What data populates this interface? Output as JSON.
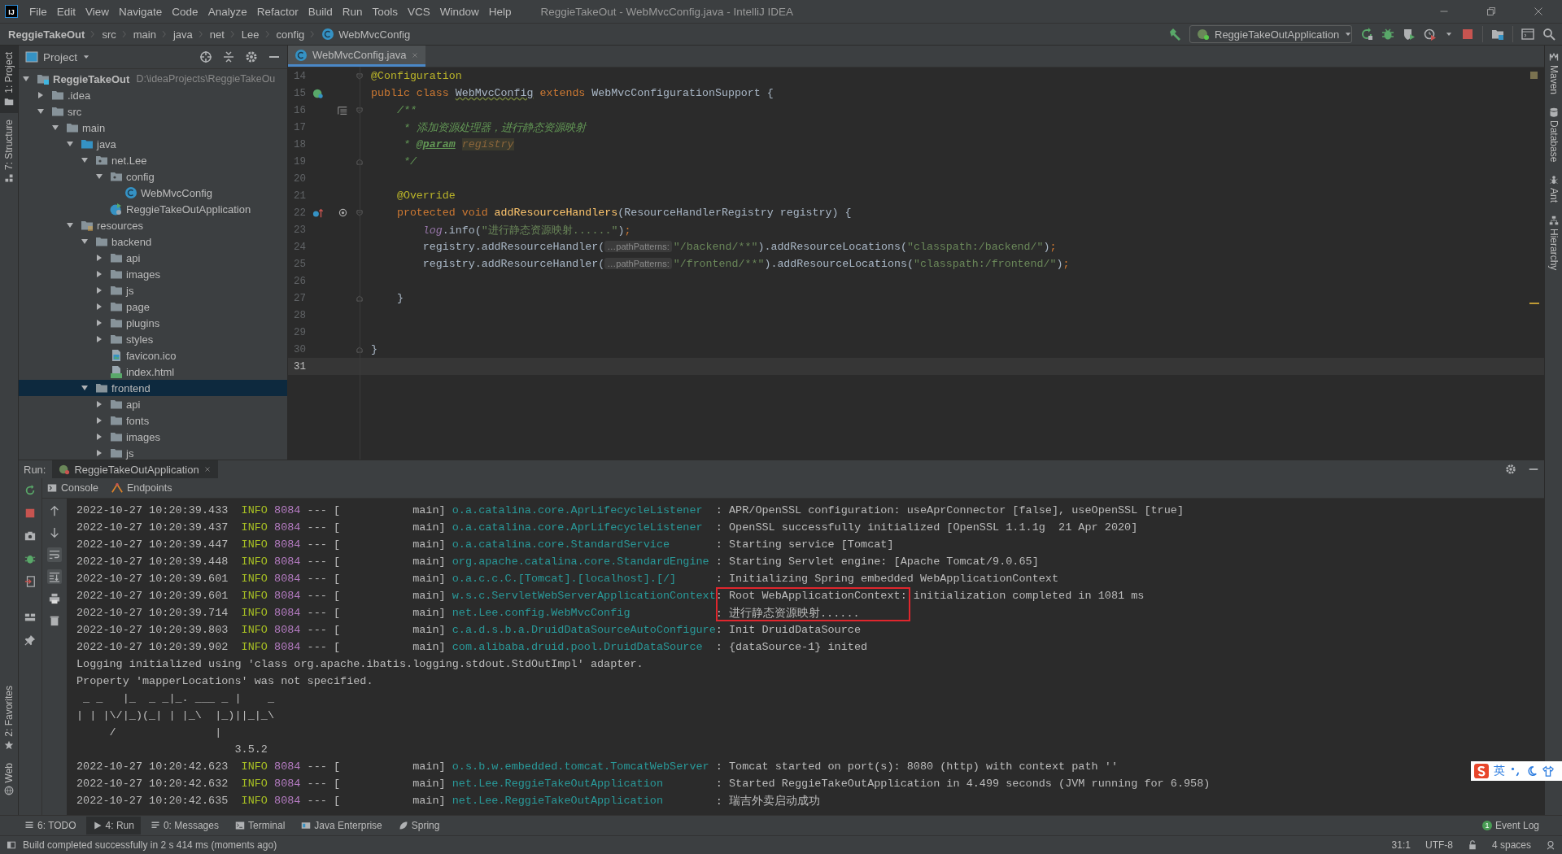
{
  "app_logo": "IJ",
  "menu": [
    "File",
    "Edit",
    "View",
    "Navigate",
    "Code",
    "Analyze",
    "Refactor",
    "Build",
    "Run",
    "Tools",
    "VCS",
    "Window",
    "Help"
  ],
  "window": {
    "title": "ReggieTakeOut - WebMvcConfig.java - IntelliJ IDEA"
  },
  "breadcrumb": [
    {
      "label": "ReggieTakeOut",
      "kind": "project"
    },
    {
      "label": "src",
      "kind": "folder"
    },
    {
      "label": "main",
      "kind": "folder"
    },
    {
      "label": "java",
      "kind": "folder"
    },
    {
      "label": "net",
      "kind": "folder"
    },
    {
      "label": "Lee",
      "kind": "folder"
    },
    {
      "label": "config",
      "kind": "folder"
    },
    {
      "label": "WebMvcConfig",
      "kind": "class"
    }
  ],
  "run_config": {
    "label": "ReggieTakeOutApplication"
  },
  "left_tool_windows": [
    {
      "label": "1: Project",
      "kind": "project",
      "selected": true
    },
    {
      "label": "7: Structure",
      "kind": "structure",
      "selected": false
    }
  ],
  "left_tool_windows_bottom": [
    {
      "label": "2: Favorites",
      "kind": "favorites",
      "selected": false
    },
    {
      "label": "Web",
      "kind": "web",
      "selected": false
    }
  ],
  "right_tool_windows": [
    {
      "label": "Maven",
      "kind": "maven"
    },
    {
      "label": "Database",
      "kind": "database"
    },
    {
      "label": "Ant",
      "kind": "ant"
    },
    {
      "label": "Hierarchy",
      "kind": "hierarchy"
    }
  ],
  "project_panel": {
    "title": "Project",
    "tree": [
      {
        "label": "ReggieTakeOut",
        "kind": "project",
        "path": "D:\\ideaProjects\\ReggieTakeOu",
        "expanded": true,
        "selected": false,
        "children": [
          {
            "label": ".idea",
            "kind": "folder",
            "expanded": false,
            "selected": false
          },
          {
            "label": "src",
            "kind": "folder",
            "expanded": true,
            "selected": false,
            "children": [
              {
                "label": "main",
                "kind": "folder",
                "expanded": true,
                "selected": false,
                "children": [
                  {
                    "label": "java",
                    "kind": "source-folder",
                    "expanded": true,
                    "selected": false,
                    "children": [
                      {
                        "label": "net.Lee",
                        "kind": "package",
                        "expanded": true,
                        "selected": false,
                        "children": [
                          {
                            "label": "config",
                            "kind": "package",
                            "expanded": true,
                            "selected": false,
                            "children": [
                              {
                                "label": "WebMvcConfig",
                                "kind": "class",
                                "selected": false
                              }
                            ]
                          },
                          {
                            "label": "ReggieTakeOutApplication",
                            "kind": "app-class",
                            "selected": false
                          }
                        ]
                      }
                    ]
                  },
                  {
                    "label": "resources",
                    "kind": "resources-folder",
                    "expanded": true,
                    "selected": false,
                    "children": [
                      {
                        "label": "backend",
                        "kind": "folder",
                        "expanded": true,
                        "selected": false,
                        "children": [
                          {
                            "label": "api",
                            "kind": "folder",
                            "expanded": false,
                            "selected": false
                          },
                          {
                            "label": "images",
                            "kind": "folder",
                            "expanded": false,
                            "selected": false
                          },
                          {
                            "label": "js",
                            "kind": "folder",
                            "expanded": false,
                            "selected": false
                          },
                          {
                            "label": "page",
                            "kind": "folder",
                            "expanded": false,
                            "selected": false
                          },
                          {
                            "label": "plugins",
                            "kind": "folder",
                            "expanded": false,
                            "selected": false
                          },
                          {
                            "label": "styles",
                            "kind": "folder",
                            "expanded": false,
                            "selected": false
                          },
                          {
                            "label": "favicon.ico",
                            "kind": "image-file",
                            "selected": false
                          },
                          {
                            "label": "index.html",
                            "kind": "html-file",
                            "selected": false
                          }
                        ]
                      },
                      {
                        "label": "frontend",
                        "kind": "folder",
                        "expanded": true,
                        "selected": true,
                        "children": [
                          {
                            "label": "api",
                            "kind": "folder",
                            "expanded": false,
                            "selected": false
                          },
                          {
                            "label": "fonts",
                            "kind": "folder",
                            "expanded": false,
                            "selected": false
                          },
                          {
                            "label": "images",
                            "kind": "folder",
                            "expanded": false,
                            "selected": false
                          },
                          {
                            "label": "js",
                            "kind": "folder",
                            "expanded": false,
                            "selected": false
                          }
                        ]
                      }
                    ]
                  }
                ]
              }
            ]
          }
        ]
      }
    ]
  },
  "editor": {
    "tabs": [
      {
        "label": "WebMvcConfig.java",
        "selected": true
      }
    ],
    "lines": [
      {
        "number": "14",
        "kind": "plain",
        "current": false,
        "fold_start": true,
        "fold_end": false,
        "tokens": [
          {
            "text": "@Configuration",
            "kind": "annotation"
          }
        ]
      },
      {
        "number": "15",
        "kind": "bean",
        "current": false,
        "fold_start": false,
        "fold_end": false,
        "tokens": [
          {
            "text": "public class ",
            "kind": "keyword"
          },
          {
            "text": "WebMvcConfig",
            "kind": "class-name"
          },
          {
            "text": " extends ",
            "kind": "keyword"
          },
          {
            "text": "WebMvcConfigurationSupport {",
            "kind": "plain"
          }
        ]
      },
      {
        "number": "16",
        "kind": "doc",
        "current": false,
        "fold_start": true,
        "fold_end": false,
        "tokens": [
          {
            "text": "    /**",
            "kind": "doc"
          }
        ]
      },
      {
        "number": "17",
        "kind": "plain",
        "current": false,
        "fold_start": false,
        "fold_end": false,
        "tokens": [
          {
            "text": "     * 添加资源处理器，进行静态资源映射",
            "kind": "doc"
          }
        ]
      },
      {
        "number": "18",
        "kind": "plain",
        "current": false,
        "fold_start": false,
        "fold_end": false,
        "tokens": [
          {
            "text": "     * ",
            "kind": "doc"
          },
          {
            "text": "@param",
            "kind": "doc-tag"
          },
          {
            "text": "registry",
            "kind": "param-ref"
          }
        ]
      },
      {
        "number": "19",
        "kind": "plain",
        "current": false,
        "fold_start": false,
        "fold_end": true,
        "tokens": [
          {
            "text": "     */",
            "kind": "doc"
          }
        ]
      },
      {
        "number": "20",
        "kind": "plain",
        "current": false,
        "fold_start": false,
        "fold_end": false
      },
      {
        "number": "21",
        "kind": "plain",
        "current": false,
        "fold_start": false,
        "fold_end": false,
        "tokens": [
          {
            "text": "    @Override",
            "kind": "annotation"
          }
        ]
      },
      {
        "number": "22",
        "kind": "override",
        "current": false,
        "fold_start": true,
        "fold_end": false,
        "tokens": [
          {
            "text": "    protected void ",
            "kind": "keyword"
          },
          {
            "text": "addResourceHandlers",
            "kind": "method-decl"
          },
          {
            "text": "(ResourceHandlerRegistry registry) {",
            "kind": "plain"
          }
        ]
      },
      {
        "number": "23",
        "kind": "plain",
        "current": false,
        "fold_start": false,
        "fold_end": false,
        "tokens": [
          {
            "text": "        log",
            "kind": "field"
          },
          {
            "text": ".info(",
            "kind": "plain"
          },
          {
            "text": "\"进行静态资源映射......\"",
            "kind": "string"
          },
          {
            "text": ")",
            "kind": "plain"
          },
          {
            "text": ";",
            "kind": "keyword"
          }
        ]
      },
      {
        "number": "24",
        "kind": "plain",
        "current": false,
        "fold_start": false,
        "fold_end": false,
        "tokens": [
          {
            "text": "        registry.addResourceHandler(",
            "kind": "plain"
          },
          {
            "text": "…pathPatterns:",
            "kind": "hint"
          },
          {
            "text": "\"/backend/**\"",
            "kind": "string"
          },
          {
            "text": ").addResourceLocations(",
            "kind": "plain"
          },
          {
            "text": "\"classpath:/backend/\"",
            "kind": "string"
          },
          {
            "text": ")",
            "kind": "plain"
          },
          {
            "text": ";",
            "kind": "keyword"
          }
        ]
      },
      {
        "number": "25",
        "kind": "plain",
        "current": false,
        "fold_start": false,
        "fold_end": false,
        "tokens": [
          {
            "text": "        registry.addResourceHandler(",
            "kind": "plain"
          },
          {
            "text": "…pathPatterns:",
            "kind": "hint"
          },
          {
            "text": "\"/frontend/**\"",
            "kind": "string"
          },
          {
            "text": ").addResourceLocations(",
            "kind": "plain"
          },
          {
            "text": "\"classpath:/frontend/\"",
            "kind": "string"
          },
          {
            "text": ")",
            "kind": "plain"
          },
          {
            "text": ";",
            "kind": "keyword"
          }
        ]
      },
      {
        "number": "26",
        "kind": "plain",
        "current": false,
        "fold_start": false,
        "fold_end": false
      },
      {
        "number": "27",
        "kind": "plain",
        "current": false,
        "fold_start": false,
        "fold_end": true,
        "tokens": [
          {
            "text": "    }",
            "kind": "plain"
          }
        ]
      },
      {
        "number": "28",
        "kind": "plain",
        "current": false,
        "fold_start": false,
        "fold_end": false
      },
      {
        "number": "29",
        "kind": "plain",
        "current": false,
        "fold_start": false,
        "fold_end": false
      },
      {
        "number": "30",
        "kind": "plain",
        "current": false,
        "fold_start": false,
        "fold_end": true,
        "tokens": [
          {
            "text": "}",
            "kind": "plain"
          }
        ]
      },
      {
        "number": "31",
        "kind": "plain",
        "current": true,
        "fold_start": false,
        "fold_end": false
      }
    ]
  },
  "run_panel": {
    "label": "Run:",
    "tabs": [
      {
        "label": "ReggieTakeOutApplication",
        "selected": true
      }
    ],
    "subtabs": [
      {
        "label": "Console",
        "kind": "console"
      },
      {
        "label": "Endpoints",
        "kind": "endpoints"
      }
    ],
    "console": [
      {
        "kind": "log",
        "boxed": false,
        "time": "2022-10-27 10:20:39.433",
        "level": "INFO",
        "pid": "8084",
        "thread": "--- [           main]",
        "logger": "o.a.catalina.core.AprLifecycleListener",
        "message": ": APR/OpenSSL configuration: useAprConnector [false], useOpenSSL [true]"
      },
      {
        "kind": "log",
        "boxed": false,
        "time": "2022-10-27 10:20:39.437",
        "level": "INFO",
        "pid": "8084",
        "thread": "--- [           main]",
        "logger": "o.a.catalina.core.AprLifecycleListener",
        "message": ": OpenSSL successfully initialized [OpenSSL 1.1.1g  21 Apr 2020]"
      },
      {
        "kind": "log",
        "boxed": false,
        "time": "2022-10-27 10:20:39.447",
        "level": "INFO",
        "pid": "8084",
        "thread": "--- [           main]",
        "logger": "o.a.catalina.core.StandardService",
        "message": ": Starting service [Tomcat]"
      },
      {
        "kind": "log",
        "boxed": false,
        "time": "2022-10-27 10:20:39.448",
        "level": "INFO",
        "pid": "8084",
        "thread": "--- [           main]",
        "logger": "org.apache.catalina.core.StandardEngine",
        "message": ": Starting Servlet engine: [Apache Tomcat/9.0.65]"
      },
      {
        "kind": "log",
        "boxed": false,
        "time": "2022-10-27 10:20:39.601",
        "level": "INFO",
        "pid": "8084",
        "thread": "--- [           main]",
        "logger": "o.a.c.c.C.[Tomcat].[localhost].[/]",
        "message": ": Initializing Spring embedded WebApplicationContext"
      },
      {
        "kind": "log",
        "boxed": true,
        "time": "2022-10-27 10:20:39.601",
        "level": "INFO",
        "pid": "8084",
        "thread": "--- [           main]",
        "logger": "w.s.c.ServletWebServerApplicationContext",
        "message": ": Root WebApplicationContext: initialization completed in 1081 ms"
      },
      {
        "kind": "log",
        "boxed": true,
        "time": "2022-10-27 10:20:39.714",
        "level": "INFO",
        "pid": "8084",
        "thread": "--- [           main]",
        "logger": "net.Lee.config.WebMvcConfig",
        "message": ": 进行静态资源映射......"
      },
      {
        "kind": "log",
        "boxed": false,
        "time": "2022-10-27 10:20:39.803",
        "level": "INFO",
        "pid": "8084",
        "thread": "--- [           main]",
        "logger": "c.a.d.s.b.a.DruidDataSourceAutoConfigure",
        "message": ": Init DruidDataSource"
      },
      {
        "kind": "log",
        "boxed": false,
        "time": "2022-10-27 10:20:39.902",
        "level": "INFO",
        "pid": "8084",
        "thread": "--- [           main]",
        "logger": "com.alibaba.druid.pool.DruidDataSource",
        "message": ": {dataSource-1} inited"
      },
      {
        "kind": "text",
        "boxed": false,
        "text": "Logging initialized using 'class org.apache.ibatis.logging.stdout.StdOutImpl' adapter."
      },
      {
        "kind": "text",
        "boxed": false,
        "text": "Property 'mapperLocations' was not specified."
      },
      {
        "kind": "text",
        "boxed": false,
        "text": " _ _   |_  _ _|_. ___ _ |    _ "
      },
      {
        "kind": "text",
        "boxed": false,
        "text": "| | |\\/|_)(_| | |_\\  |_)||_|_\\ "
      },
      {
        "kind": "text",
        "boxed": false,
        "text": "     /               |         "
      },
      {
        "kind": "text",
        "boxed": false,
        "text": "                        3.5.2 "
      },
      {
        "kind": "log",
        "boxed": false,
        "time": "2022-10-27 10:20:42.623",
        "level": "INFO",
        "pid": "8084",
        "thread": "--- [           main]",
        "logger": "o.s.b.w.embedded.tomcat.TomcatWebServer",
        "message": ": Tomcat started on port(s): 8080 (http) with context path ''"
      },
      {
        "kind": "log",
        "boxed": false,
        "time": "2022-10-27 10:20:42.632",
        "level": "INFO",
        "pid": "8084",
        "thread": "--- [           main]",
        "logger": "net.Lee.ReggieTakeOutApplication",
        "message": ": Started ReggieTakeOutApplication in 4.499 seconds (JVM running for 6.958)"
      },
      {
        "kind": "log",
        "boxed": false,
        "time": "2022-10-27 10:20:42.635",
        "level": "INFO",
        "pid": "8084",
        "thread": "--- [           main]",
        "logger": "net.Lee.ReggieTakeOutApplication",
        "message": ": 瑞吉外卖启动成功"
      }
    ]
  },
  "tool_window_bar": [
    {
      "label": "6: TODO",
      "kind": "todo",
      "selected": false
    },
    {
      "label": "4: Run",
      "kind": "run",
      "selected": true
    },
    {
      "label": "0: Messages",
      "kind": "messages",
      "selected": false
    },
    {
      "label": "Terminal",
      "kind": "terminal",
      "selected": false
    },
    {
      "label": "Java Enterprise",
      "kind": "java-enterprise",
      "selected": false
    },
    {
      "label": "Spring",
      "kind": "spring",
      "selected": false
    }
  ],
  "event_log": {
    "label": "Event Log",
    "count": "1"
  },
  "ime_toolbar": {
    "mode": "英"
  },
  "status_bar": {
    "message": "Build completed successfully in 2 s 414 ms (moments ago)",
    "position": "31:1",
    "encoding": "UTF-8",
    "indent": "4 spaces"
  }
}
